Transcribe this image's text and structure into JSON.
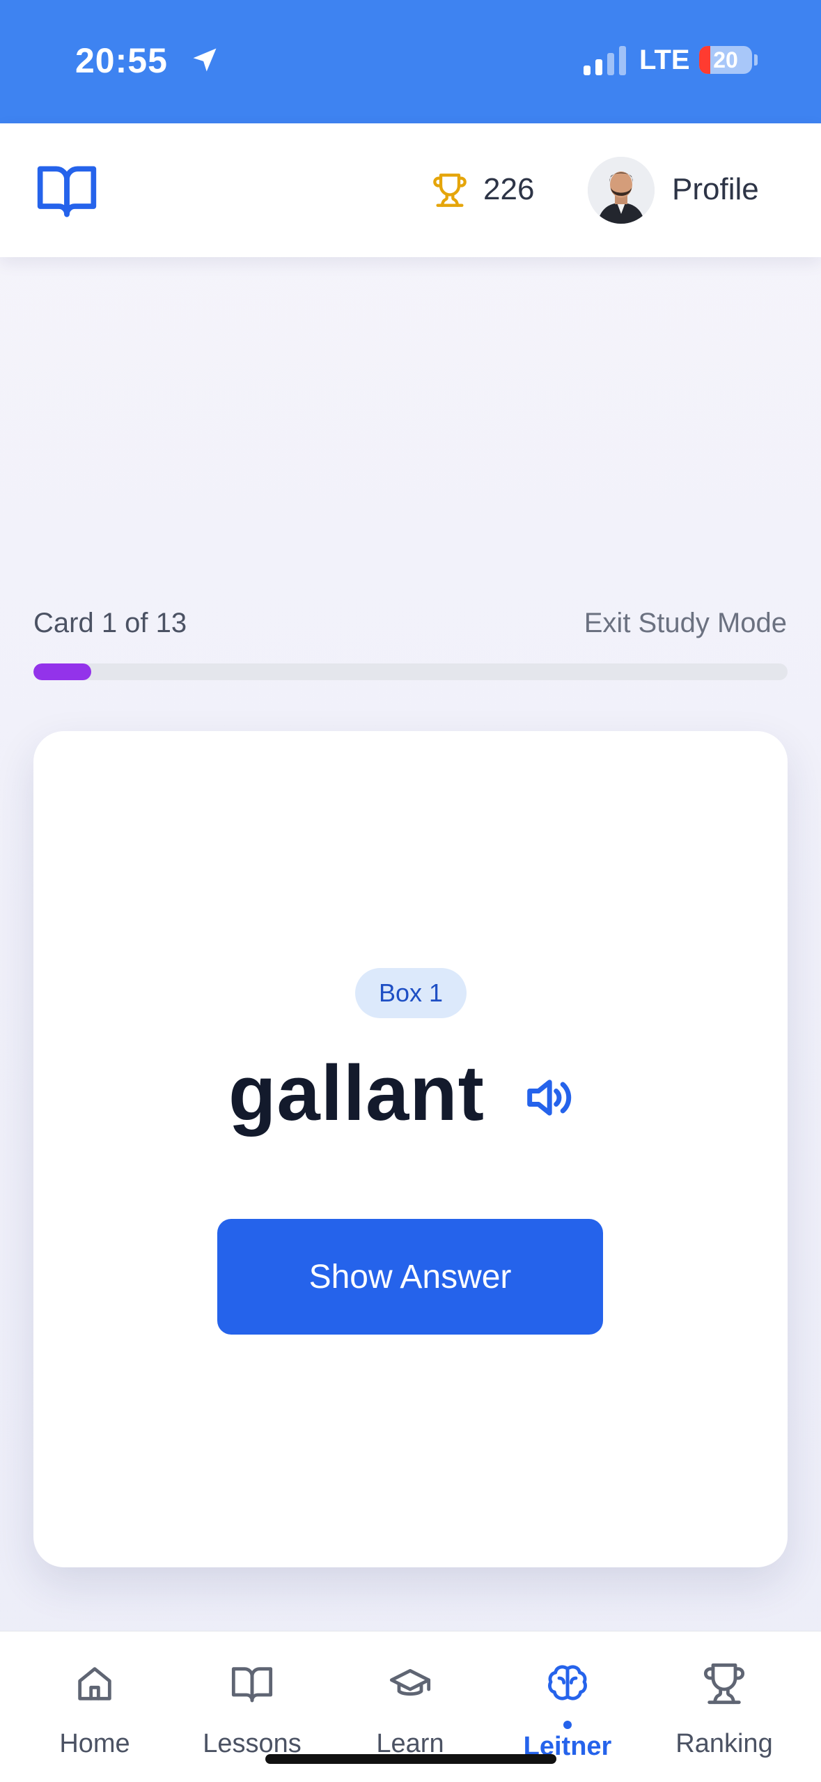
{
  "status_bar": {
    "time": "20:55",
    "network": "LTE",
    "battery": "20"
  },
  "header": {
    "points": "226",
    "profile_label": "Profile"
  },
  "study": {
    "card_counter": "Card 1 of 13",
    "exit_label": "Exit Study Mode",
    "progress_fraction": 0.077,
    "progress_color": "#9333ea"
  },
  "flashcard": {
    "box_label": "Box 1",
    "word": "gallant",
    "show_answer_label": "Show Answer"
  },
  "bottom_nav": {
    "active": "Leitner",
    "items": [
      {
        "label": "Home",
        "icon": "home-icon"
      },
      {
        "label": "Lessons",
        "icon": "book-icon"
      },
      {
        "label": "Learn",
        "icon": "graduation-cap-icon"
      },
      {
        "label": "Leitner",
        "icon": "brain-icon"
      },
      {
        "label": "Ranking",
        "icon": "trophy-icon"
      }
    ]
  },
  "colors": {
    "status_bar": "#3e83f1",
    "primary": "#2563eb",
    "trophy": "#e5a50a",
    "badge_bg": "#dce9fb"
  }
}
